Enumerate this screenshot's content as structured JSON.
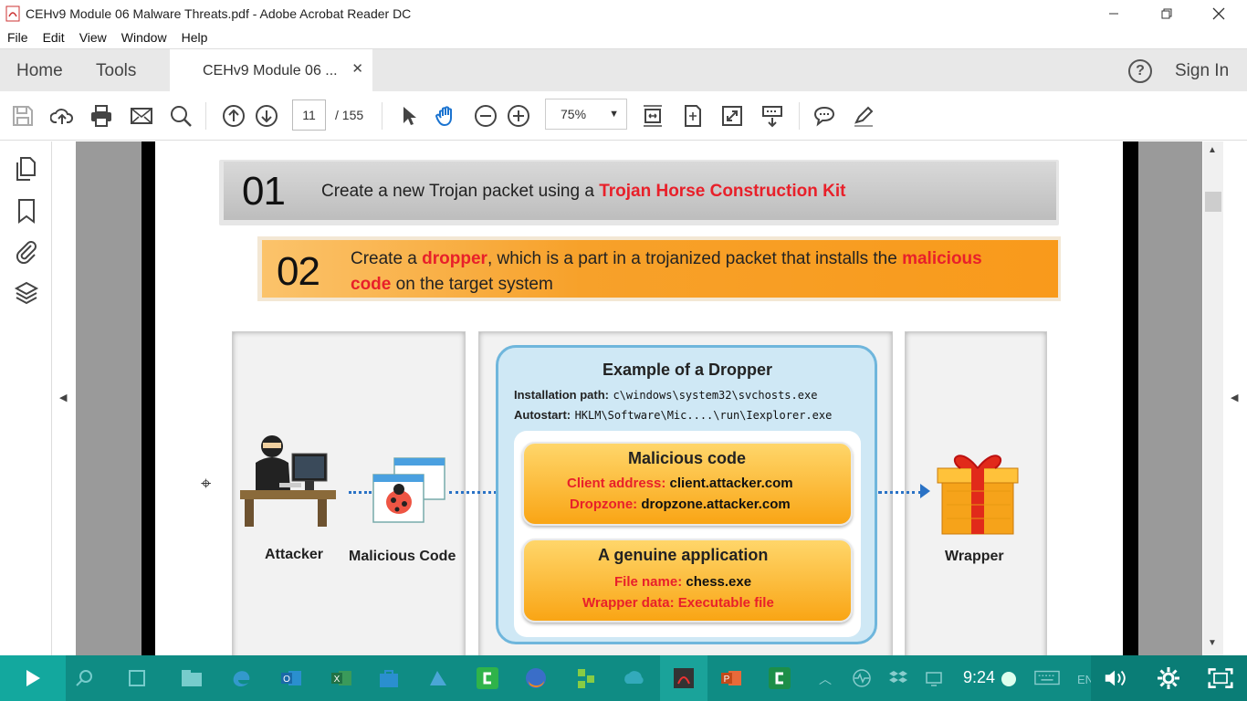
{
  "window": {
    "title": "CEHv9 Module 06 Malware Threats.pdf - Adobe Acrobat Reader DC"
  },
  "menu": [
    "File",
    "Edit",
    "View",
    "Window",
    "Help"
  ],
  "nav": {
    "home": "Home",
    "tools": "Tools",
    "doc_tab": "CEHv9 Module 06 ...",
    "sign_in": "Sign In"
  },
  "toolbar": {
    "page_current": "11",
    "page_total": "/  155",
    "zoom": "75%"
  },
  "slide": {
    "step1": {
      "num": "01",
      "text": "Create a new Trojan packet using a ",
      "highlight": "Trojan Horse Construction Kit"
    },
    "step2": {
      "num": "02",
      "text_a": "Create a ",
      "hl_a": "dropper",
      "text_b": ", which is a part in a trojanized packet that installs the ",
      "hl_b": "malicious",
      "hl_c": "code",
      "text_c": " on the target system"
    },
    "attacker_label": "Attacker",
    "malcode_label": "Malicious Code",
    "wrapper_label": "Wrapper",
    "dropper": {
      "title": "Example of a Dropper",
      "install_label": "Installation path:",
      "install_value": "c\\windows\\system32\\svchosts.exe",
      "autostart_label": "Autostart:",
      "autostart_value": "HKLM\\Software\\Mic....\\run\\Iexplorer.exe",
      "malicious": {
        "title": "Malicious code",
        "client_label": "Client address:",
        "client_value": "client.attacker.com",
        "dropzone_label": "Dropzone:",
        "dropzone_value": "dropzone.attacker.com"
      },
      "genuine": {
        "title": "A genuine application",
        "file_label": "File name:",
        "file_value": "chess.exe",
        "wrapper_label": "Wrapper data:",
        "wrapper_value": "Executable file"
      }
    }
  },
  "taskbar": {
    "time": "9:24",
    "lang": "EN"
  },
  "colors": {
    "accent_red": "#e8202a",
    "orange": "#f7a12a",
    "taskbar": "#0f8c84"
  }
}
